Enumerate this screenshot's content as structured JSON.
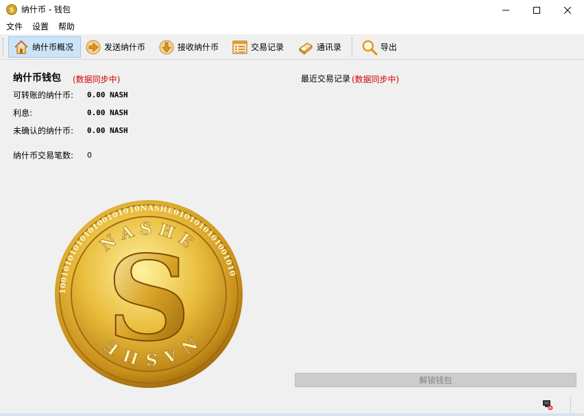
{
  "window": {
    "title": "纳什币 - 钱包",
    "app_icon": "nashcoin-app-icon"
  },
  "menu": {
    "items": [
      {
        "label": "文件"
      },
      {
        "label": "设置"
      },
      {
        "label": "帮助"
      }
    ]
  },
  "toolbar": {
    "items": [
      {
        "label": "纳什币概况",
        "icon": "home-icon",
        "active": true
      },
      {
        "label": "发送纳什币",
        "icon": "send-arrow-icon",
        "active": false
      },
      {
        "label": "接收纳什币",
        "icon": "receive-arrow-icon",
        "active": false
      },
      {
        "label": "交易记录",
        "icon": "list-icon",
        "active": false
      },
      {
        "label": "通讯录",
        "icon": "address-book-icon",
        "active": false
      },
      {
        "label": "导出",
        "icon": "magnifier-icon",
        "active": false
      }
    ]
  },
  "wallet": {
    "title": "纳什币钱包",
    "sync_status": "(数据同步中)",
    "balance_label": "可转账的纳什币:",
    "balance_value": "0.00 NASH",
    "interest_label": "利息:",
    "interest_value": "0.00 NASH",
    "unconfirmed_label": "未确认的纳什币:",
    "unconfirmed_value": "0.00 NASH",
    "tx_count_label": "纳什币交易笔数:",
    "tx_count_value": "0"
  },
  "recent": {
    "title": "最近交易记录",
    "sync_status": "(数据同步中)"
  },
  "coin": {
    "top_text": "NASHE",
    "bottom_text": "NASHE",
    "ring_text": "1001010101010100101010NASHE0101010101001010",
    "letter": "S"
  },
  "unlock": {
    "label": "解锁钱包"
  },
  "colors": {
    "sync_red": "#d40000",
    "active_tab_bg": "#cce4f7",
    "gold": "#d8a21f"
  }
}
